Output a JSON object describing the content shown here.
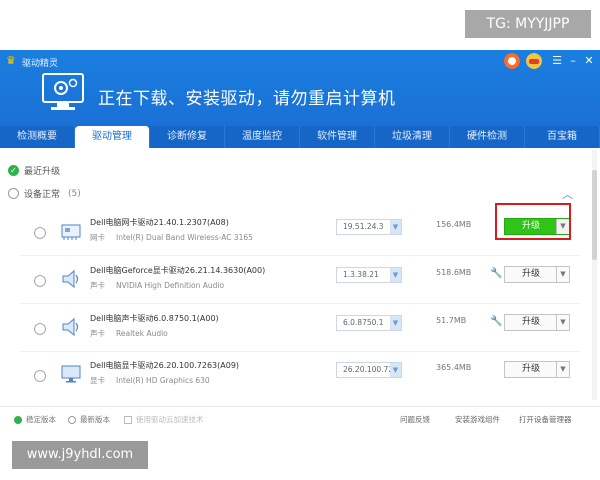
{
  "app": {
    "name": "驱动精灵"
  },
  "hero": {
    "status": "正在下载、安装驱动，请勿重启计算机"
  },
  "tabs": [
    "检测概要",
    "驱动管理",
    "诊断修复",
    "温度监控",
    "软件管理",
    "垃圾清理",
    "硬件检测",
    "百宝箱"
  ],
  "active_tab": "驱动管理",
  "sections": {
    "recent": {
      "label": "最近升级"
    },
    "normal": {
      "label": "设备正常",
      "count": "(5)"
    }
  },
  "drivers": [
    {
      "name": "Dell电脑网卡驱动21.40.1.2307(A08)",
      "type": "网卡",
      "device": "Intel(R) Dual Band Wireless-AC 3165",
      "version": "19.51.24.3",
      "size": "156.4MB",
      "button": "升级",
      "icon": "network-card-icon",
      "highlighted": true
    },
    {
      "name": "Dell电脑Geforce显卡驱动26.21.14.3630(A00)",
      "type": "声卡",
      "device": "NVIDIA High Definition Audio",
      "version": "1.3.38.21",
      "size": "518.6MB",
      "button": "升级",
      "icon": "speaker-icon",
      "highlighted": false
    },
    {
      "name": "Dell电脑声卡驱动6.0.8750.1(A00)",
      "type": "声卡",
      "device": "Realtek Audio",
      "version": "6.0.8750.1",
      "size": "51.7MB",
      "button": "升级",
      "icon": "speaker-icon",
      "highlighted": false
    },
    {
      "name": "Dell电脑显卡驱动26.20.100.7263(A09)",
      "type": "显卡",
      "device": "Intel(R) HD Graphics 630",
      "version": "26.20.100.72",
      "size": "365.4MB",
      "button": "升级",
      "icon": "monitor-icon",
      "highlighted": false
    }
  ],
  "footer": {
    "stable": "稳定版本",
    "latest": "最新版本",
    "cloud": "使用驱动云加速技术",
    "feedback": "问题反馈",
    "game": "安装游戏组件",
    "devmgr": "打开设备管理器"
  },
  "watermarks": {
    "top": "TG: MYYJJPP",
    "bottom": "www.j9yhdl.com"
  },
  "colors": {
    "header": "#1a7fe0",
    "tab_bar": "#1666c7",
    "primary_button": "#2fc516",
    "highlight": "#d61c1c",
    "check": "#2fb14b"
  }
}
